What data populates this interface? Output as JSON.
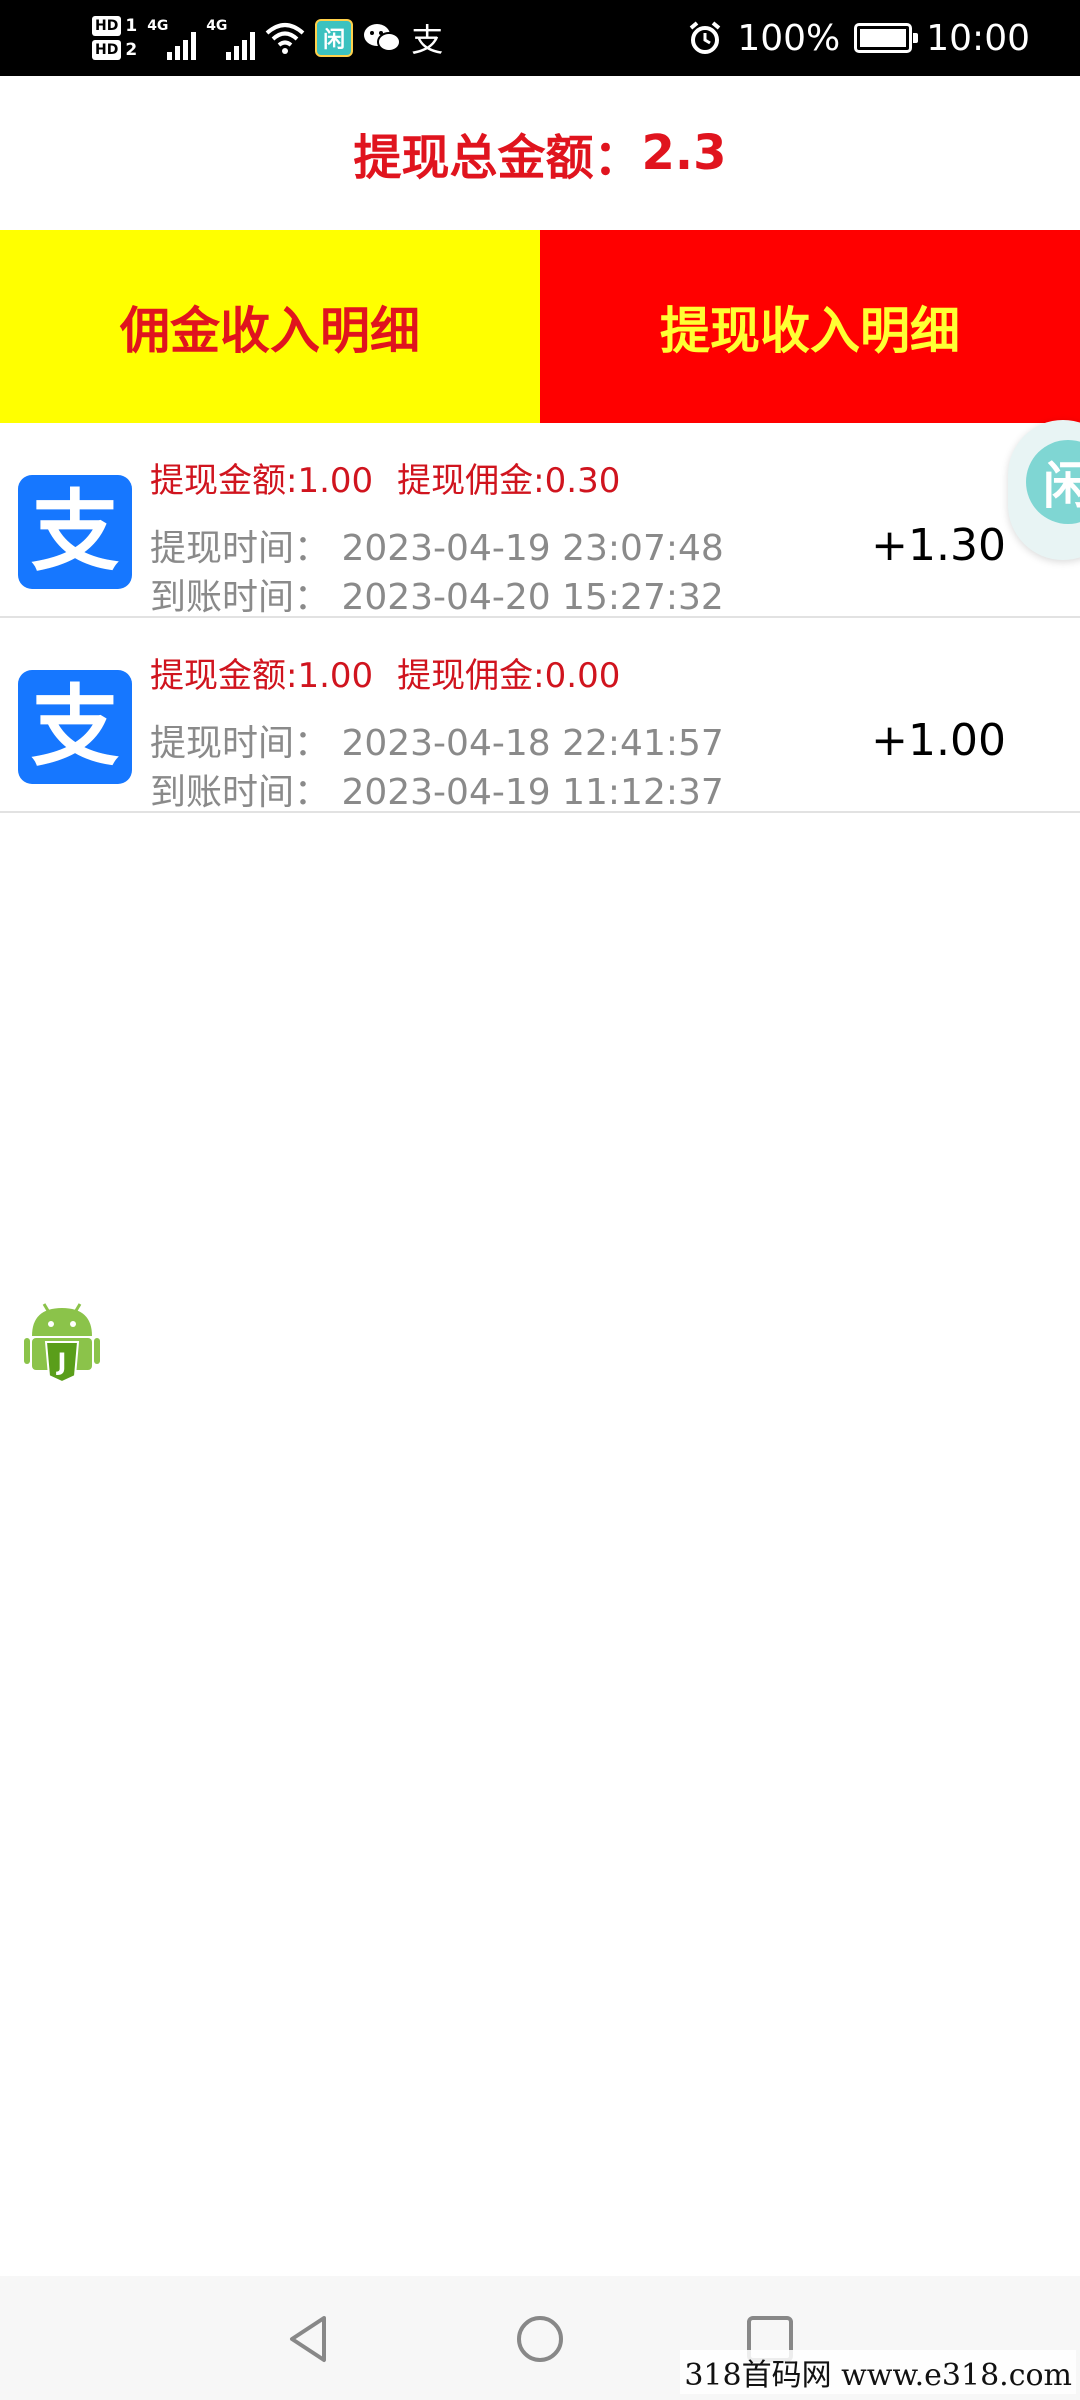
{
  "status_bar": {
    "sim1": "HD",
    "sim1_num": "1",
    "sim2": "HD",
    "sim2_num": "2",
    "network1": "4G",
    "network2": "4G",
    "app_icon_char": "闲",
    "alipay_glyph": "支",
    "battery_text": "100%",
    "battery_level": 1.0,
    "time": "10:00"
  },
  "header": {
    "total_label": "提现总金额：",
    "total_value": "2.3"
  },
  "tabs": [
    {
      "label": "佣金收入明细",
      "color": "#ffff00"
    },
    {
      "label": "提现收入明细",
      "color": "#ff0000"
    }
  ],
  "records": [
    {
      "icon_char": "支",
      "amount_label": "提现金额:1.00",
      "commission_label": "提现佣金:0.30",
      "withdraw_time": "提现时间：  2023-04-19 23:07:48",
      "arrive_time": "到账时间：  2023-04-20 15:27:32",
      "total": "+1.30"
    },
    {
      "icon_char": "支",
      "amount_label": "提现金额:1.00",
      "commission_label": "提现佣金:0.00",
      "withdraw_time": "提现时间：  2023-04-18 22:41:57",
      "arrive_time": "到账时间：  2023-04-19 11:12:37",
      "total": "+1.00"
    }
  ],
  "floating": {
    "xian_char": "闲",
    "android_badge": "J"
  },
  "watermark": "318首码网  www.e318.com",
  "colors": {
    "accent_red": "#e0141e",
    "alipay_blue": "#1677ff",
    "tab_yellow": "#ffff00",
    "tab_red": "#ff0000"
  }
}
